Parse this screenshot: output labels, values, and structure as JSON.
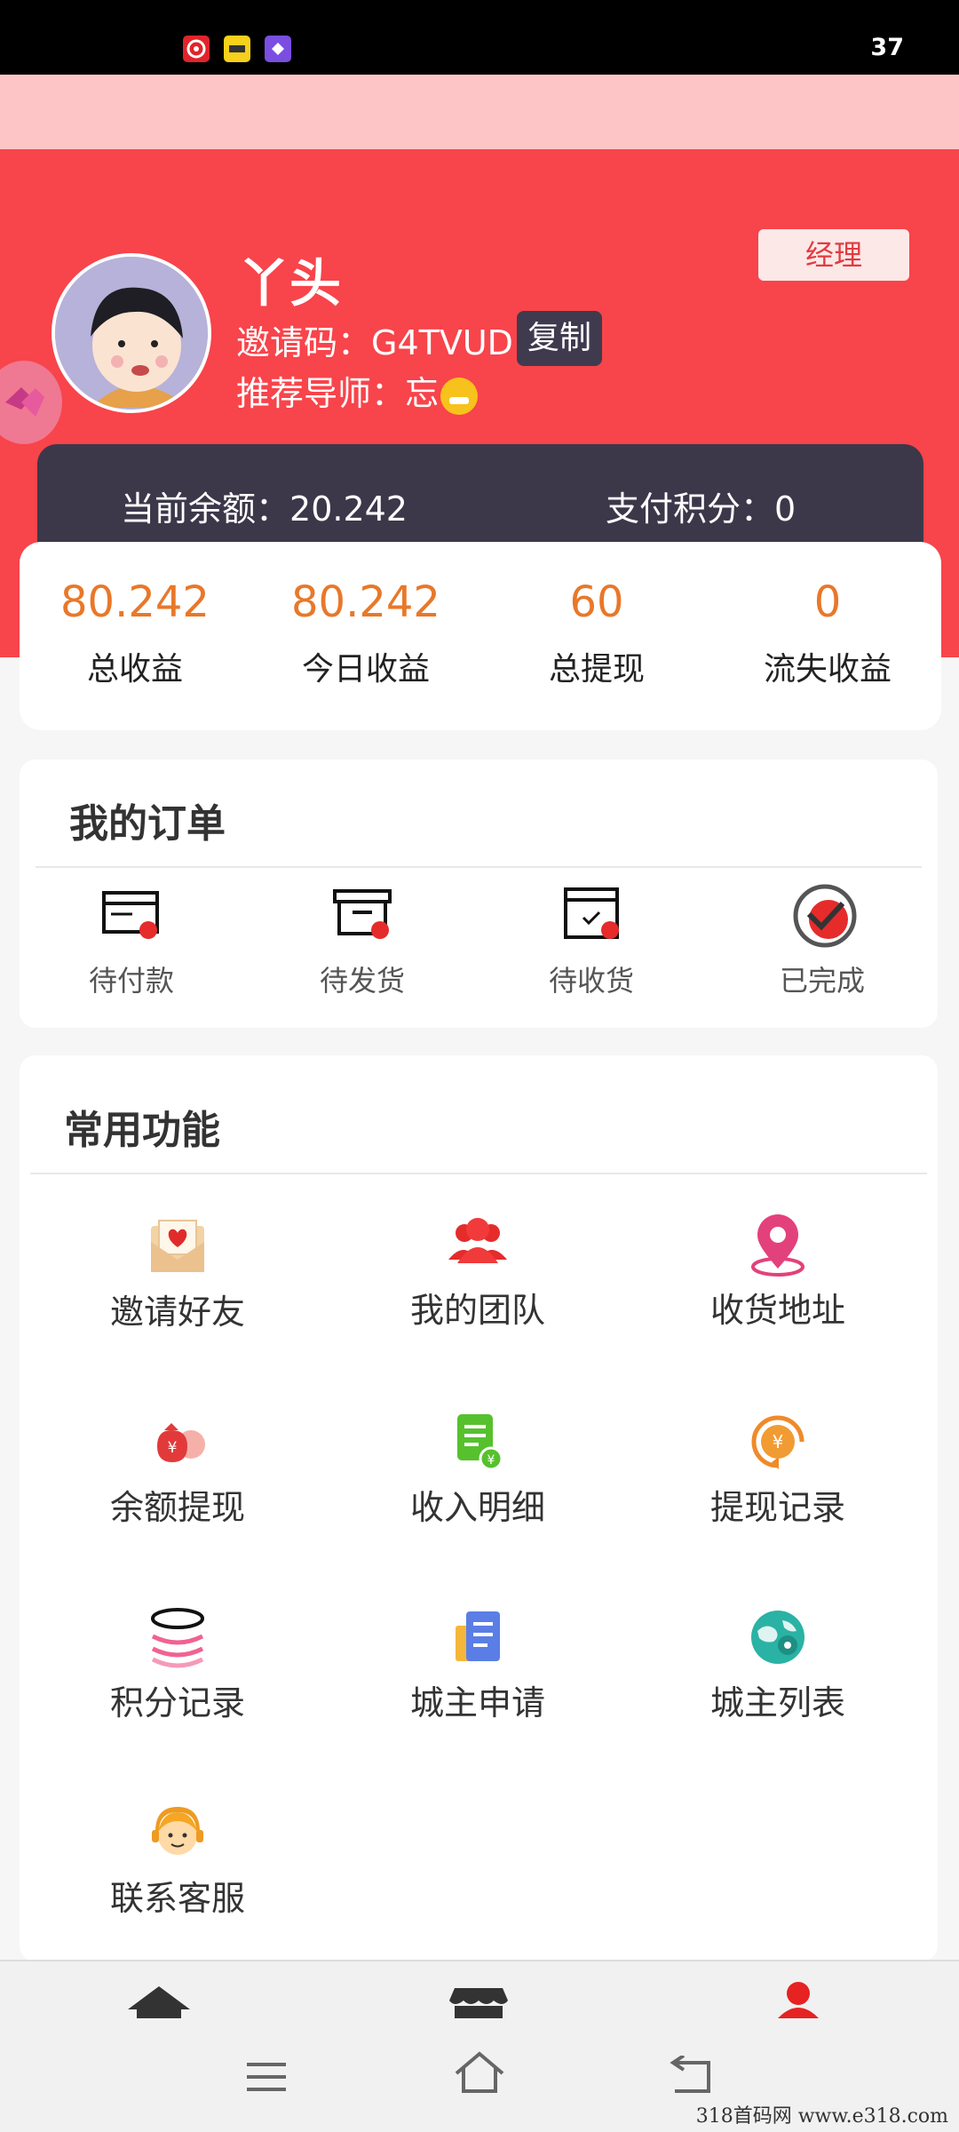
{
  "status_bar": {
    "time": "37",
    "app_icons": [
      "netease-music-icon",
      "meituan-icon",
      "shortcut-app-icon"
    ],
    "colors": {
      "netease": "#e1242b",
      "meituan": "#f6d01a",
      "shortcut": "#7a4ee0"
    }
  },
  "profile": {
    "name": "丫头",
    "invite_label": "邀请码：",
    "invite_code": "G4TVUD",
    "copy_label": "复制",
    "mentor_label": "推荐导师：",
    "mentor_name": "忘",
    "role_badge": "经理"
  },
  "balance": {
    "current_label": "当前余额：",
    "current_value": "20.242",
    "points_label": "支付积分：",
    "points_value": "0"
  },
  "stats": [
    {
      "value": "80.242",
      "label": "总收益"
    },
    {
      "value": "80.242",
      "label": "今日收益"
    },
    {
      "value": "60",
      "label": "总提现"
    },
    {
      "value": "0",
      "label": "流失收益"
    }
  ],
  "orders": {
    "title": "我的订单",
    "items": [
      {
        "label": "待付款",
        "icon": "wallet-card-icon"
      },
      {
        "label": "待发货",
        "icon": "package-box-icon"
      },
      {
        "label": "待收货",
        "icon": "delivery-box-icon"
      },
      {
        "label": "已完成",
        "icon": "check-circle-icon"
      }
    ]
  },
  "functions": {
    "title": "常用功能",
    "items": [
      {
        "label": "邀请好友",
        "icon": "invite-envelope-icon"
      },
      {
        "label": "我的团队",
        "icon": "team-people-icon"
      },
      {
        "label": "收货地址",
        "icon": "location-pin-icon"
      },
      {
        "label": "余额提现",
        "icon": "money-bag-icon"
      },
      {
        "label": "收入明细",
        "icon": "income-document-icon"
      },
      {
        "label": "提现记录",
        "icon": "withdraw-coin-icon"
      },
      {
        "label": "积分记录",
        "icon": "points-stack-icon"
      },
      {
        "label": "城主申请",
        "icon": "apply-document-icon"
      },
      {
        "label": "城主列表",
        "icon": "globe-map-icon"
      },
      {
        "label": "联系客服",
        "icon": "customer-service-icon"
      }
    ]
  },
  "bottom_nav": {
    "items": [
      "home-icon",
      "store-icon",
      "profile-icon"
    ],
    "active": "profile-icon"
  },
  "system_nav": [
    "menu-icon",
    "home-outline-icon",
    "back-icon"
  ],
  "watermark": "318首码网   www.e318.com",
  "colors": {
    "header_red": "#f8444b",
    "accent_orange": "#e8782a",
    "dark_card": "#3c384a",
    "pink_bar": "#fec5c6"
  }
}
